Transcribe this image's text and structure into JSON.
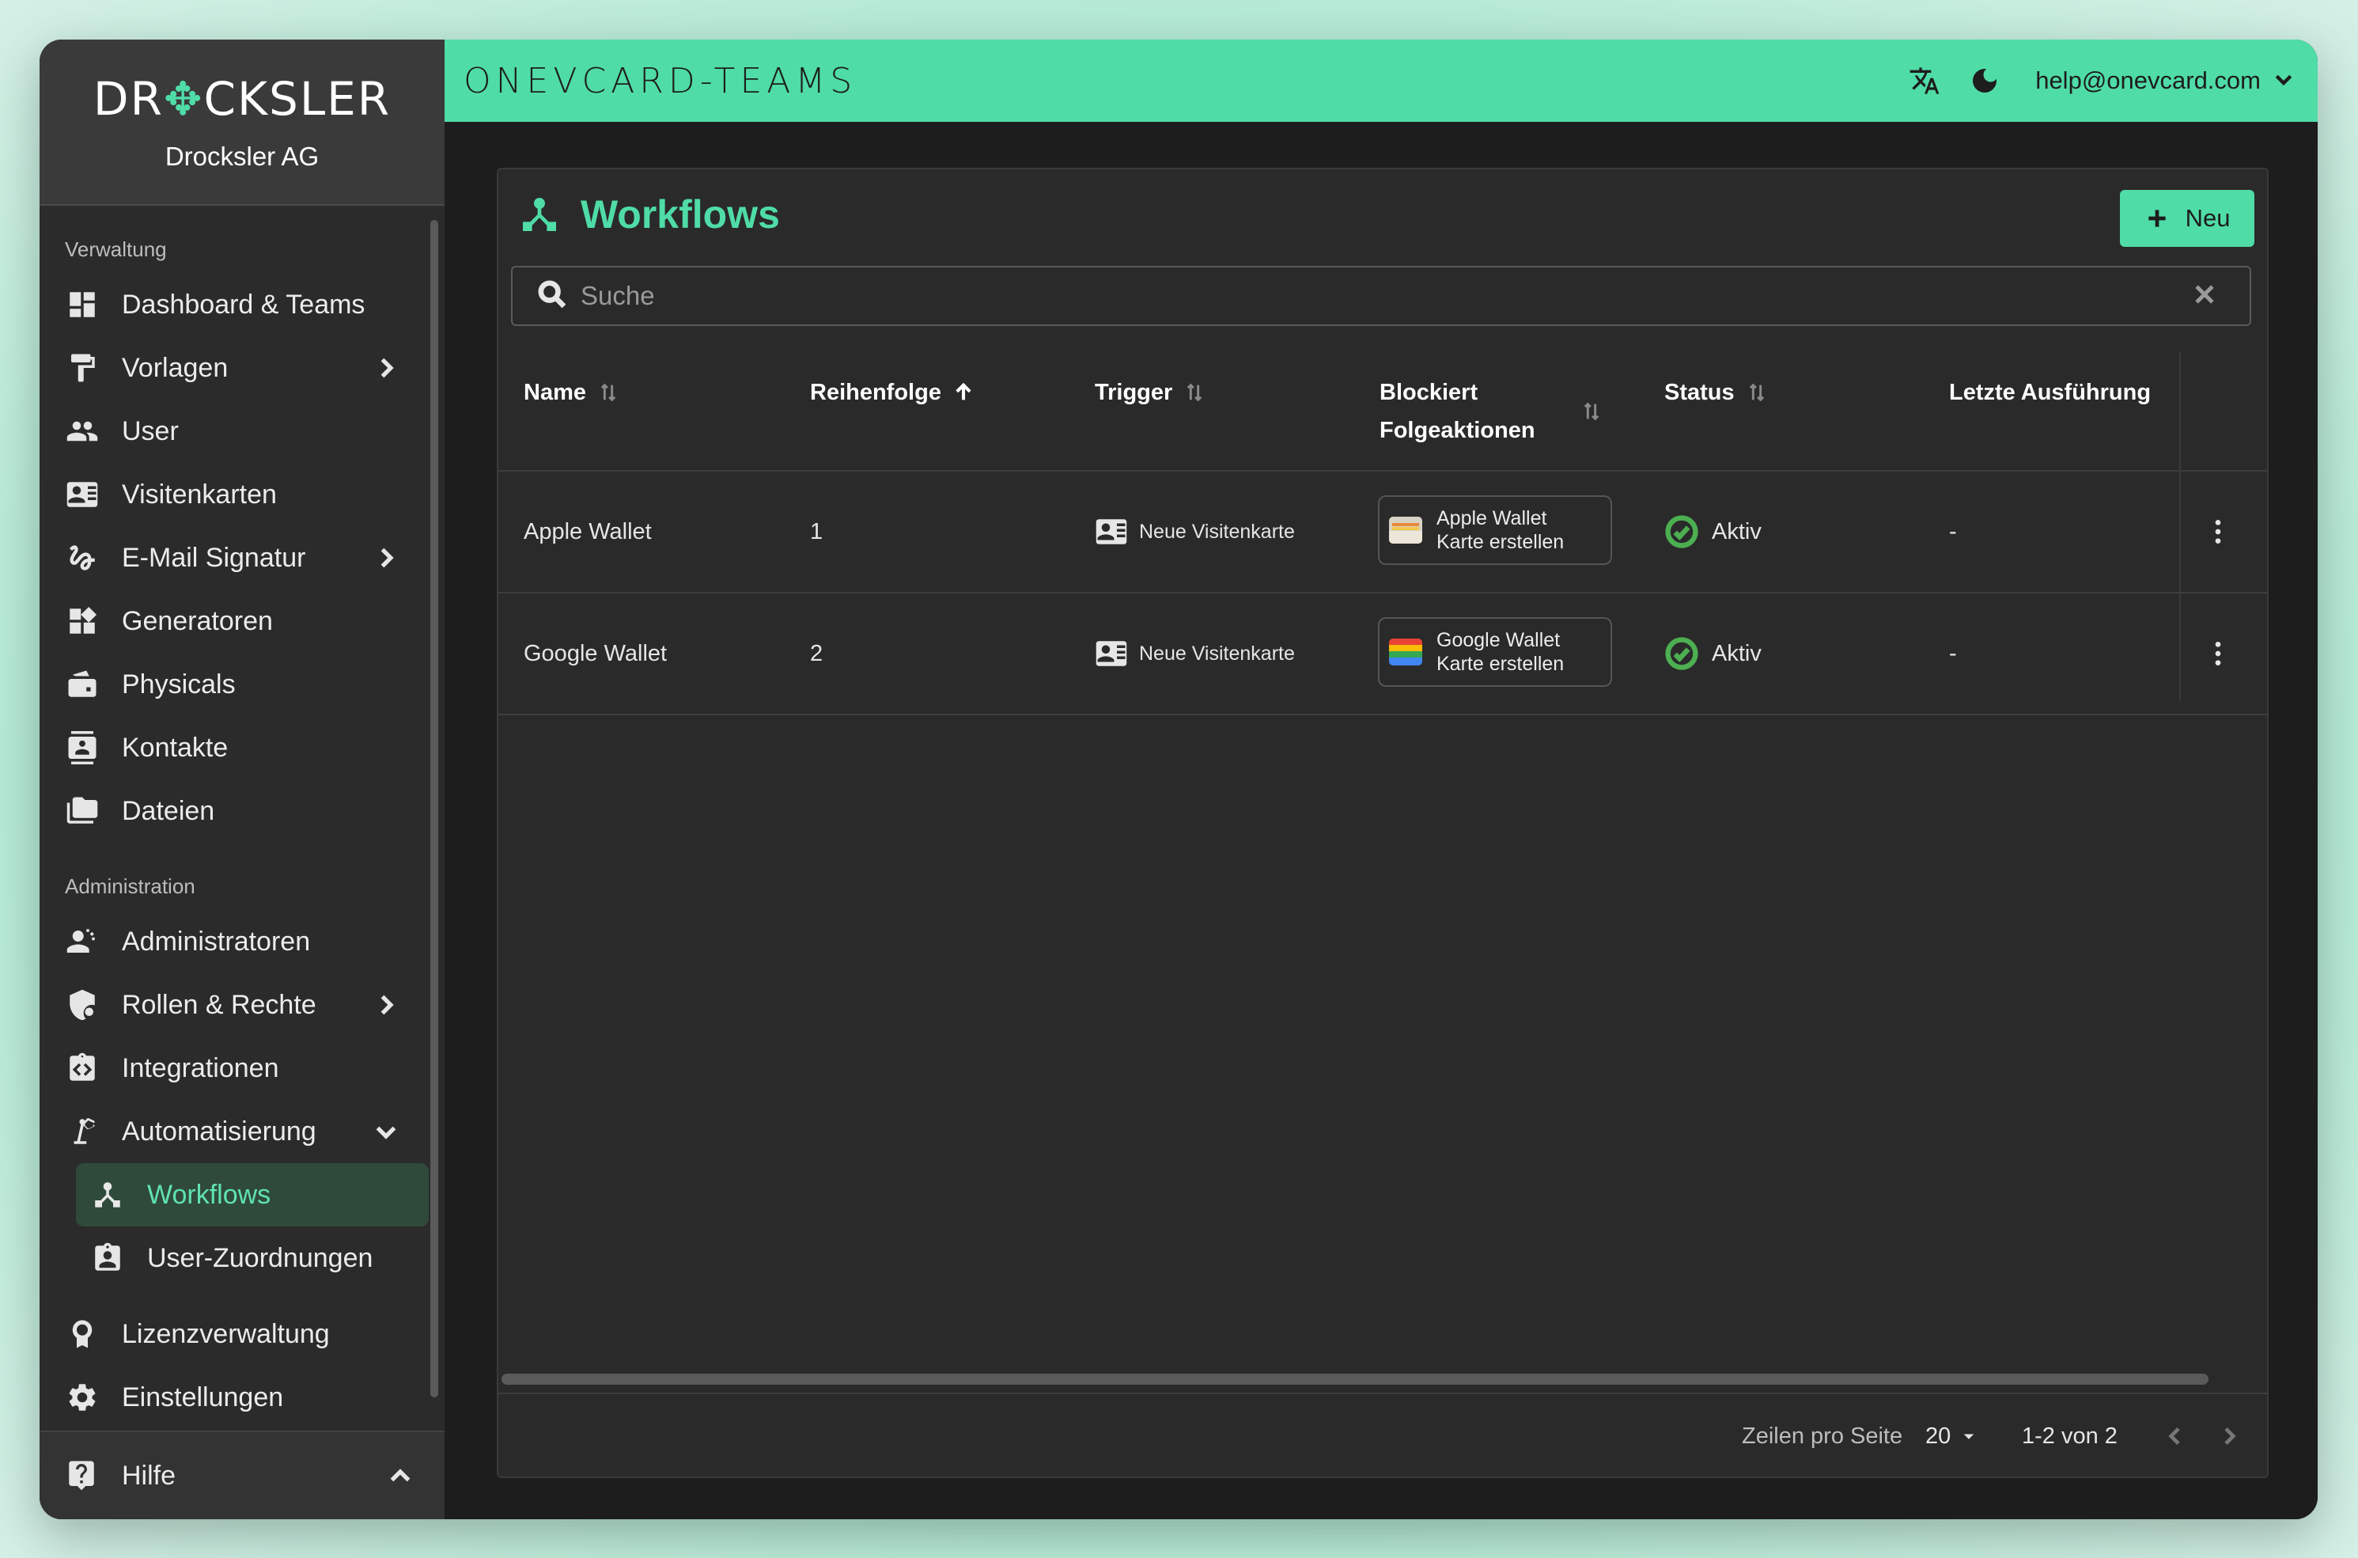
{
  "brand": {
    "logo_left": "DR",
    "logo_right": "CKSLER",
    "company": "Drocksler AG"
  },
  "app_title": "ONEVCARD-TEAMS",
  "header": {
    "user_email": "help@onevcard.com"
  },
  "sidebar": {
    "section_verwaltung": "Verwaltung",
    "section_administration": "Administration",
    "items": {
      "dashboard": "Dashboard & Teams",
      "vorlagen": "Vorlagen",
      "user": "User",
      "visitenkarten": "Visitenkarten",
      "email_signatur": "E-Mail Signatur",
      "generatoren": "Generatoren",
      "physicals": "Physicals",
      "kontakte": "Kontakte",
      "dateien": "Dateien",
      "administratoren": "Administratoren",
      "rollen": "Rollen & Rechte",
      "integrationen": "Integrationen",
      "automatisierung": "Automatisierung",
      "workflows": "Workflows",
      "user_zuordnungen": "User-Zuordnungen",
      "lizenzverwaltung": "Lizenzverwaltung",
      "einstellungen": "Einstellungen",
      "hilfe": "Hilfe"
    }
  },
  "page": {
    "title": "Workflows",
    "new_button": "Neu",
    "search_placeholder": "Suche"
  },
  "table": {
    "columns": {
      "name": "Name",
      "reihenfolge": "Reihenfolge",
      "trigger": "Trigger",
      "blockiert_1": "Blockiert",
      "blockiert_2": "Folgeaktionen",
      "status": "Status",
      "letzte": "Letzte Ausführung"
    },
    "rows": [
      {
        "name": "Apple Wallet",
        "order": "1",
        "trigger": "Neue Visitenkarte",
        "action_1": "Apple Wallet",
        "action_2": "Karte erstellen",
        "status": "Aktiv",
        "last_run": "-"
      },
      {
        "name": "Google Wallet",
        "order": "2",
        "trigger": "Neue Visitenkarte",
        "action_1": "Google Wallet",
        "action_2": "Karte erstellen",
        "status": "Aktiv",
        "last_run": "-"
      }
    ]
  },
  "pagination": {
    "rows_label": "Zeilen pro Seite",
    "rows_value": "20",
    "range": "1-2 von 2"
  },
  "colors": {
    "accent": "#4fdca6",
    "status_ok": "#4caf50",
    "sidebar_bg": "#2b2b2b",
    "card_bg": "#2a2a2a"
  }
}
